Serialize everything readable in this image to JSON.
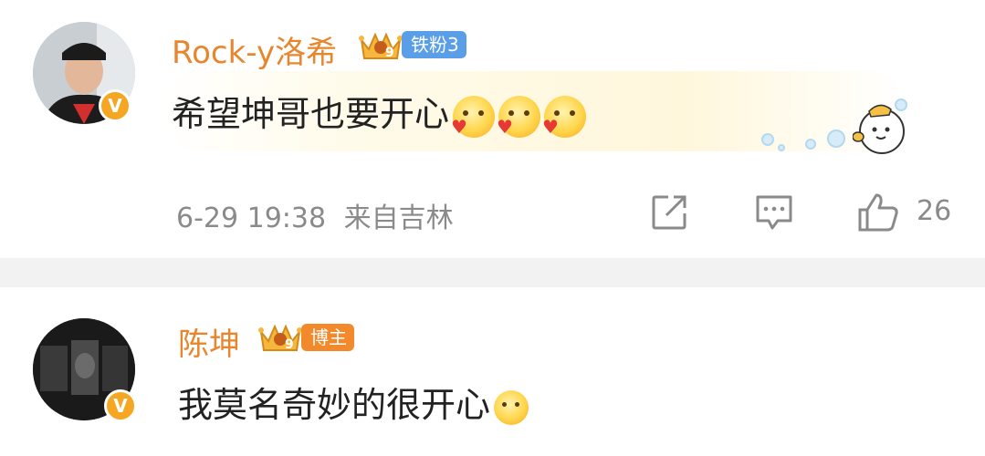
{
  "comments": [
    {
      "username": "Rock-y洛希",
      "fan_badge": "铁粉3",
      "crown_level": "9",
      "verified_badge": "V",
      "text": "希望坤哥也要开心",
      "emoji_names": [
        "shy-heart-emoji",
        "shy-heart-emoji",
        "shy-heart-emoji"
      ],
      "timestamp": "6-29 19:38",
      "location": "来自吉林",
      "like_count": "26",
      "actions": [
        "share-icon",
        "comment-icon",
        "like-icon"
      ],
      "highlight_mascot": "duckling-mascot-icon"
    },
    {
      "username": "陈坤",
      "fan_badge": "博主",
      "crown_level": "9",
      "verified_badge": "V",
      "text": "我莫名奇妙的很开心",
      "emoji_names": [
        "giggle-emoji"
      ]
    }
  ],
  "colors": {
    "username": "#e8862e",
    "fan_badge_blue": "#5b9ee8",
    "fan_badge_orange": "#f28a2c",
    "verified": "#f5a623",
    "meta_text": "#8a8a8a",
    "separator": "#f2f2f2"
  }
}
